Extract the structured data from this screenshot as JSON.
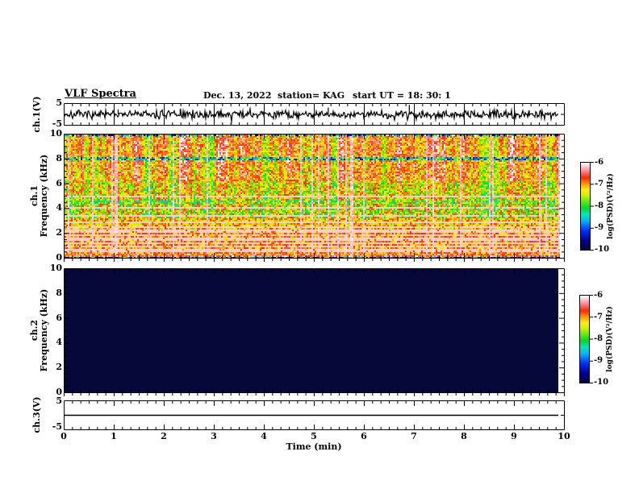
{
  "header": {
    "title": "VLF Spectra",
    "date": "Dec. 13, 2022",
    "station": "station= KAG",
    "start_ut": "start UT =  18: 30: 1"
  },
  "time_axis": {
    "label": "Time (min)",
    "tick_labels": [
      "0",
      "1",
      "2",
      "3",
      "4",
      "5",
      "6",
      "7",
      "8",
      "9",
      "10"
    ],
    "minor_divisions": 6
  },
  "panels": {
    "ch1_wave": {
      "ylabel": "ch.1(V)",
      "ytick_labels": [
        "5",
        "-5"
      ],
      "yrange": [
        -5,
        5
      ]
    },
    "ch1_spec": {
      "ylabel_lines": [
        "ch.1",
        "Frequency (kHz)"
      ],
      "ytick_labels": [
        "10",
        "8",
        "6",
        "4",
        "2",
        "0"
      ],
      "yrange": [
        0,
        10
      ]
    },
    "ch2_spec": {
      "ylabel_lines": [
        "ch.2",
        "Frequency (kHz)"
      ],
      "ytick_labels": [
        "10",
        "8",
        "6",
        "4",
        "2",
        "0"
      ],
      "yrange": [
        0,
        10
      ]
    },
    "ch3_wave": {
      "ylabel": "ch.3(V)",
      "ytick_labels": [
        "5",
        "-5"
      ],
      "yrange": [
        -5,
        5
      ]
    }
  },
  "colorbar": {
    "label": "log(PSD)(V²/Hz)",
    "tick_labels": [
      "-6",
      "-7",
      "-8",
      "-9",
      "-10"
    ],
    "range": [
      -10,
      -6
    ]
  },
  "chart_data": {
    "type": "heatmap",
    "title": "VLF Spectra",
    "date": "Dec. 13, 2022",
    "station": "KAG",
    "start_ut": "18:30:1",
    "x": {
      "label": "Time (min)",
      "range_min": [
        0,
        10
      ],
      "major_tick_step_min": 1,
      "minor_tick_step_s": 10,
      "data_end_min": 9.89
    },
    "colormap": {
      "scale_label": "log(PSD)(V²/Hz)",
      "range": [
        -10,
        -6
      ],
      "stops": [
        [
          0,
          "#06083a"
        ],
        [
          0.1,
          "#000090"
        ],
        [
          0.22,
          "#0030ff"
        ],
        [
          0.33,
          "#00b4ff"
        ],
        [
          0.41,
          "#00e8b0"
        ],
        [
          0.48,
          "#00d830"
        ],
        [
          0.56,
          "#66ee00"
        ],
        [
          0.63,
          "#d6f000"
        ],
        [
          0.69,
          "#ffee00"
        ],
        [
          0.76,
          "#ff9400"
        ],
        [
          0.83,
          "#ff2a00"
        ],
        [
          0.9,
          "#ff7a84"
        ],
        [
          0.96,
          "#ffc9d2"
        ],
        [
          1,
          "#ffffff"
        ]
      ]
    },
    "panels": [
      {
        "id": "ch1_wave",
        "type": "line",
        "ylabel": "ch.1(V)",
        "yrange": [
          -5,
          5
        ],
        "description": "noisy trace near 0 V with occasional downward spikes",
        "baseline_v": 0,
        "noise_v": 0.45,
        "spikes": [
          {
            "t_min": 1.08,
            "v": -2.4
          },
          {
            "t_min": 1.42,
            "v": -2.1
          },
          {
            "t_min": 2.32,
            "v": -2.6
          },
          {
            "t_min": 3.12,
            "v": -1.6
          },
          {
            "t_min": 4.25,
            "v": -1.7
          },
          {
            "t_min": 5.28,
            "v": -3.3
          },
          {
            "t_min": 6.9,
            "v": -4.5
          },
          {
            "t_min": 7.15,
            "v": -1.6
          },
          {
            "t_min": 8.62,
            "v": -1.5
          },
          {
            "t_min": 9.3,
            "v": -1.9
          }
        ]
      },
      {
        "id": "ch1_spec",
        "type": "spectrogram",
        "ylabel": "Frequency (kHz)",
        "yrange_khz": [
          0,
          10
        ],
        "description": "broadband activity mostly -7 to -6.2 log PSD (red/white) with green-yellow speckle, bursty vertical white streaks, dark speckled band near 8 kHz, rainbow speckle at 10 kHz, dark base below 0.2 kHz, thin white horizontal interference lines",
        "dominant_level": -7,
        "white_line_freqs_khz": [
          0.55,
          0.75,
          0.95,
          1.2,
          1.45,
          1.6,
          1.85,
          2.1,
          2.3,
          2.55,
          2.9,
          3.5,
          4.1,
          5.05,
          6.1
        ],
        "dark_band_khz": 8.0,
        "green_band_khz": 4.65,
        "seed": 20221213
      },
      {
        "id": "ch2_spec",
        "type": "spectrogram",
        "ylabel": "Frequency (kHz)",
        "yrange_khz": [
          0,
          10
        ],
        "description": "no signal - uniform minimum level (solid black panel)",
        "fill_level": -10
      },
      {
        "id": "ch3_wave",
        "type": "line",
        "ylabel": "ch.3(V)",
        "yrange": [
          -5,
          5
        ],
        "description": "flat line at 0 V",
        "baseline_v": 0,
        "noise_v": 0
      }
    ]
  }
}
